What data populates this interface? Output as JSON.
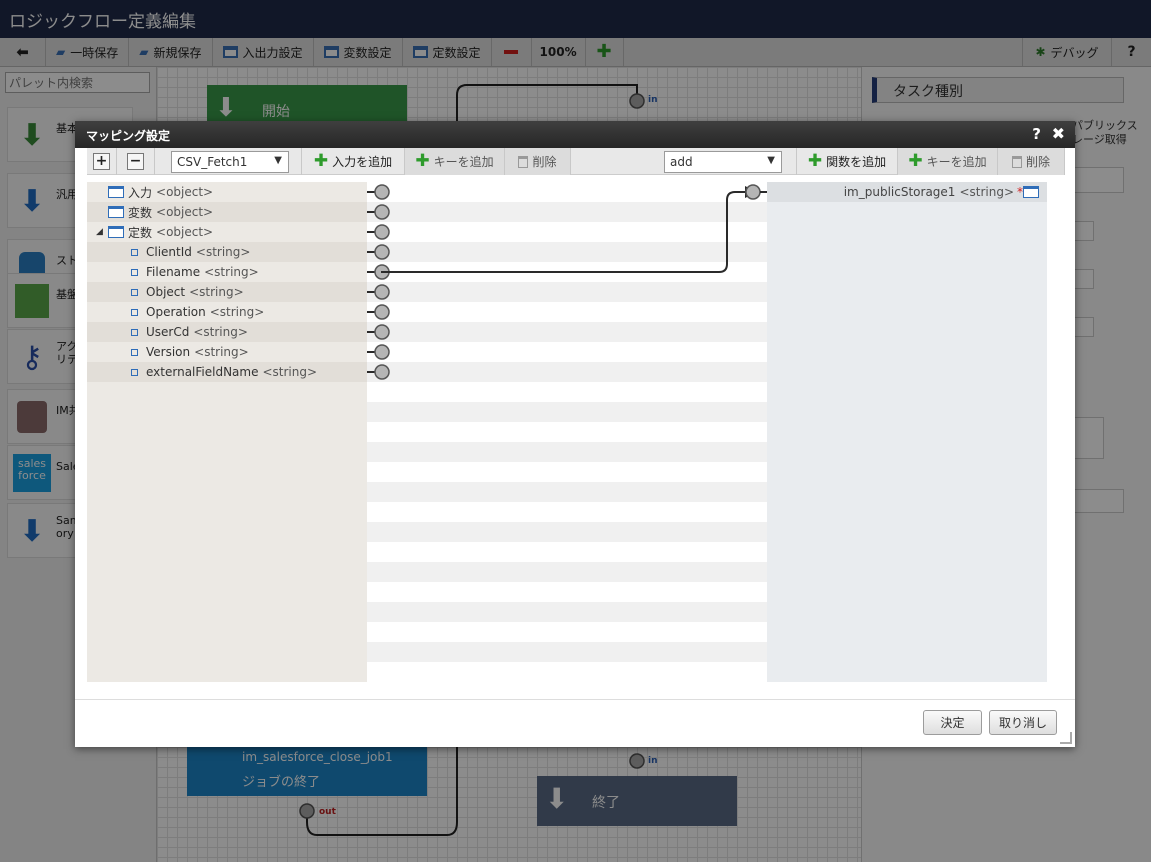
{
  "app": {
    "title": "ロジックフロー定義編集"
  },
  "toolbar": {
    "back_icon": "back-arrow-icon",
    "temp_save": "一時保存",
    "new_save": "新規保存",
    "io_settings": "入出力設定",
    "var_settings": "変数設定",
    "const_settings": "定数設定",
    "zoom": "100%",
    "debug": "デバッグ",
    "help": "?"
  },
  "palette": {
    "search_placeholder": "パレット内検索",
    "items": [
      {
        "label": "基本"
      },
      {
        "label": "汎用"
      },
      {
        "label": "スト"
      },
      {
        "label": "基盤"
      },
      {
        "label": "アク\nリテ"
      },
      {
        "label": "IM共"
      },
      {
        "label": "Sale",
        "icon_text": "sales\nforce"
      },
      {
        "label": "Sam\nory"
      }
    ]
  },
  "canvas": {
    "start_label": "開始",
    "in_label": "in",
    "job_title": "im_salesforce_close_job1",
    "job_label": "ジョブの終了",
    "out_label": "out",
    "end_label": "終了"
  },
  "right_panel": {
    "task_kind": "タスク種別",
    "public_storage_label": "パブリックス\nレージ取得"
  },
  "modal": {
    "title": "マッピング設定",
    "help": "?",
    "close": "✖",
    "left_select": "CSV_Fetch1",
    "add_input": "入力を追加",
    "add_key_left": "キーを追加",
    "delete_left": "削除",
    "right_select": "add",
    "add_function": "関数を追加",
    "add_key_right": "キーを追加",
    "delete_right": "削除",
    "left_rows": [
      {
        "name": "入力",
        "type": "<object>",
        "kind": "object",
        "expand": ""
      },
      {
        "name": "変数",
        "type": "<object>",
        "kind": "object",
        "expand": ""
      },
      {
        "name": "定数",
        "type": "<object>",
        "kind": "object",
        "expand": "◢"
      },
      {
        "name": "ClientId",
        "type": "<string>",
        "kind": "string",
        "expand": ""
      },
      {
        "name": "Filename",
        "type": "<string>",
        "kind": "string",
        "expand": ""
      },
      {
        "name": "Object",
        "type": "<string>",
        "kind": "string",
        "expand": ""
      },
      {
        "name": "Operation",
        "type": "<string>",
        "kind": "string",
        "expand": ""
      },
      {
        "name": "UserCd",
        "type": "<string>",
        "kind": "string",
        "expand": ""
      },
      {
        "name": "Version",
        "type": "<string>",
        "kind": "string",
        "expand": ""
      },
      {
        "name": "externalFieldName",
        "type": "<string>",
        "kind": "string",
        "expand": ""
      }
    ],
    "right_rows": [
      {
        "name": "im_publicStorage1",
        "type": "<string>",
        "required": "*"
      }
    ],
    "ok_button": "決定",
    "cancel_button": "取り消し"
  }
}
